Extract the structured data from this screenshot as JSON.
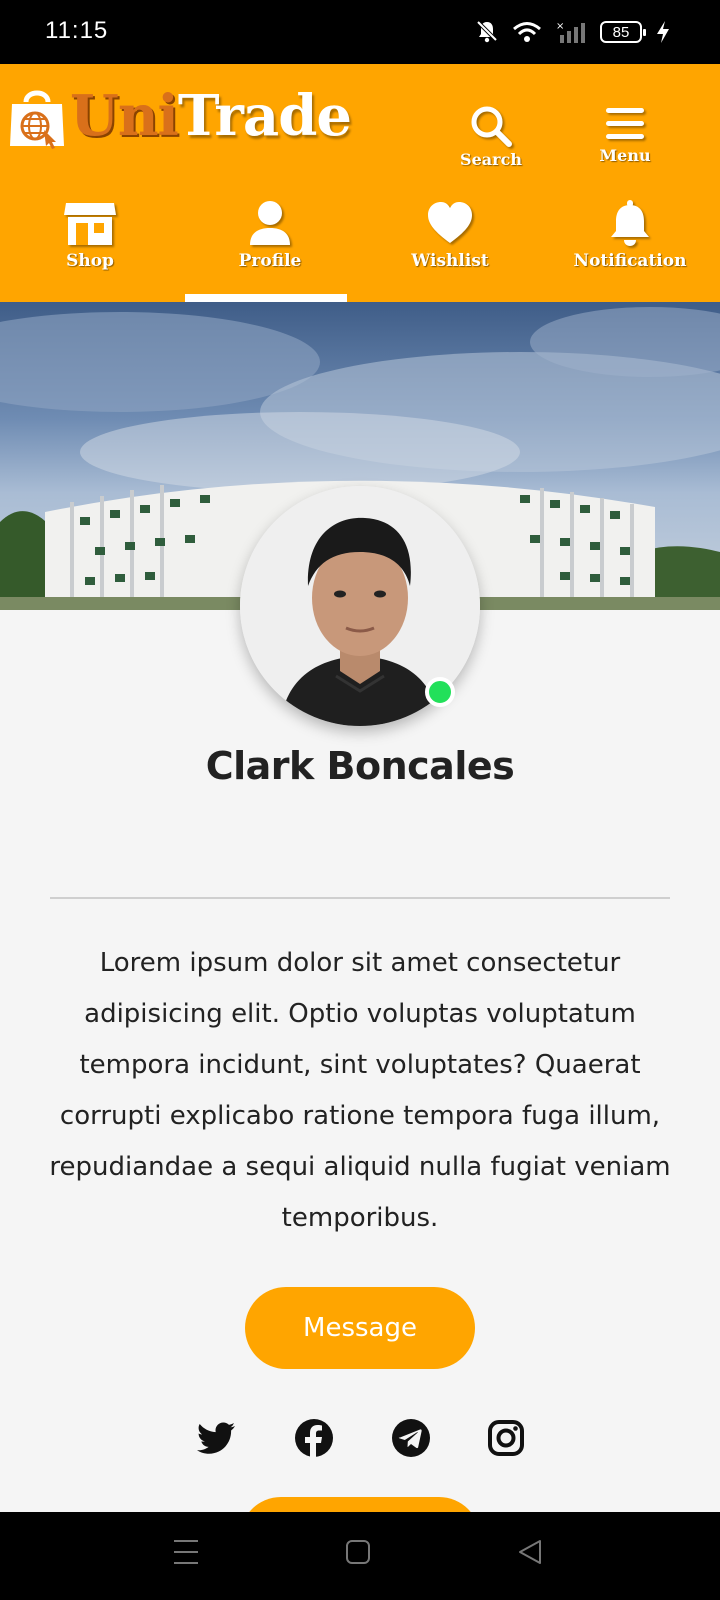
{
  "status_bar": {
    "time": "11:15",
    "battery_level": "85",
    "icons": [
      "bell-off-icon",
      "wifi-icon",
      "signal-icon",
      "battery-icon",
      "charging-icon"
    ]
  },
  "header": {
    "brand_part1": "Uni",
    "brand_part2": "Trade",
    "search_label": "Search",
    "menu_label": "Menu",
    "colors": {
      "primary": "#FFA500",
      "brand_accent": "#D9701A"
    }
  },
  "nav_tabs": [
    {
      "label": "Shop",
      "icon": "shop-icon",
      "active": false
    },
    {
      "label": "Profile",
      "icon": "user-icon",
      "active": true
    },
    {
      "label": "Wishlist",
      "icon": "heart-icon",
      "active": false
    },
    {
      "label": "Notification",
      "icon": "bell-icon",
      "active": false
    }
  ],
  "profile": {
    "name": "Clark Boncales",
    "online": true,
    "bio": "Lorem ipsum dolor sit amet consectetur adipisicing elit. Optio voluptas voluptatum tempora incidunt, sint voluptates? Quaerat corrupti explicabo ratione tempora fuga illum, repudiandae a sequi aliquid nulla fugiat veniam temporibus.",
    "message_button": "Message",
    "socials": [
      "twitter-icon",
      "facebook-icon",
      "telegram-icon",
      "instagram-icon"
    ]
  },
  "system_nav": [
    "menu-lines-icon",
    "home-square-icon",
    "back-triangle-icon"
  ]
}
